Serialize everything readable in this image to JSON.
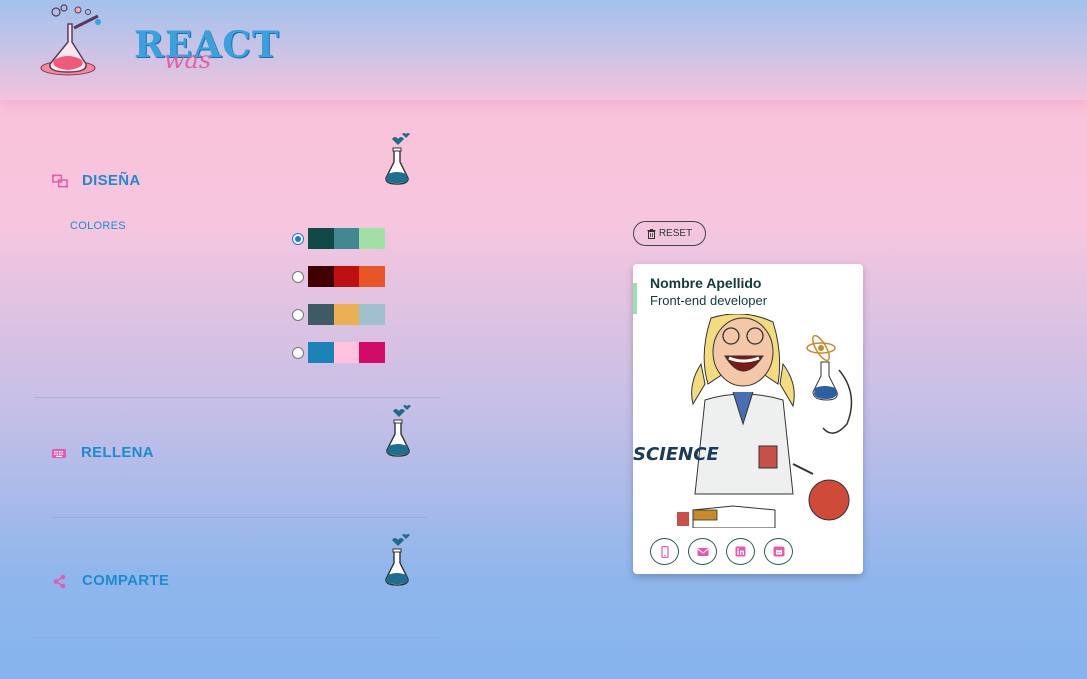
{
  "header": {
    "logo_text": "REACT",
    "logo_sub": "was"
  },
  "sections": {
    "design": {
      "title": "DISEÑA",
      "colors_label": "COLORES"
    },
    "fill": {
      "title": "RELLENA"
    },
    "share": {
      "title": "COMPARTE"
    }
  },
  "palettes": [
    {
      "selected": true,
      "colors": [
        "#114946",
        "#438792",
        "#a0dfa6"
      ]
    },
    {
      "selected": false,
      "colors": [
        "#420101",
        "#bd1010",
        "#e95626"
      ]
    },
    {
      "selected": false,
      "colors": [
        "#3e5b65",
        "#eab052",
        "#a0c0cf"
      ]
    },
    {
      "selected": false,
      "colors": [
        "#1b83b8",
        "#ffc3dd",
        "#d30a67"
      ]
    }
  ],
  "preview": {
    "reset_label": "RESET",
    "card": {
      "name": "Nombre Apellido",
      "job": "Front-end developer",
      "illustration_text": "SCIENCE"
    },
    "social_icons": [
      "phone-icon",
      "email-icon",
      "linkedin-icon",
      "github-icon"
    ]
  },
  "colors": {
    "accent": "#1f8ad0",
    "icon_pink": "#e45ab0"
  }
}
